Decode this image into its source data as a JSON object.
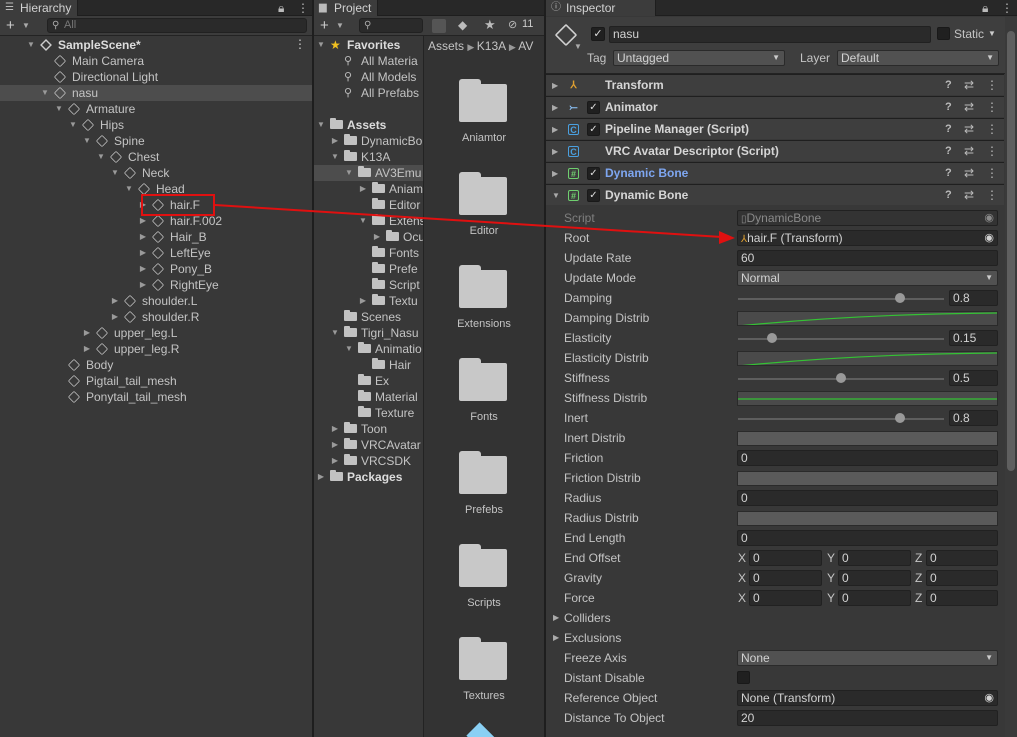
{
  "hierarchy": {
    "tab": "Hierarchy",
    "search_placeholder": "All",
    "items": [
      {
        "label": "SampleScene*",
        "indent": 0,
        "fold": "open",
        "icon": "unity-scene-icon",
        "bold": true
      },
      {
        "label": "Main Camera",
        "indent": 1,
        "fold": "",
        "icon": "gameobject-icon"
      },
      {
        "label": "Directional Light",
        "indent": 1,
        "fold": "",
        "icon": "gameobject-icon"
      },
      {
        "label": "nasu",
        "indent": 1,
        "fold": "open",
        "icon": "gameobject-icon",
        "selected": true
      },
      {
        "label": "Armature",
        "indent": 2,
        "fold": "open",
        "icon": "gameobject-icon"
      },
      {
        "label": "Hips",
        "indent": 3,
        "fold": "open",
        "icon": "gameobject-icon"
      },
      {
        "label": "Spine",
        "indent": 4,
        "fold": "open",
        "icon": "gameobject-icon"
      },
      {
        "label": "Chest",
        "indent": 5,
        "fold": "open",
        "icon": "gameobject-icon"
      },
      {
        "label": "Neck",
        "indent": 6,
        "fold": "open",
        "icon": "gameobject-icon"
      },
      {
        "label": "Head",
        "indent": 7,
        "fold": "open",
        "icon": "gameobject-icon"
      },
      {
        "label": "hair.F",
        "indent": 8,
        "fold": "closed",
        "icon": "gameobject-icon",
        "highlight": true
      },
      {
        "label": "hair.F.002",
        "indent": 8,
        "fold": "closed",
        "icon": "gameobject-icon"
      },
      {
        "label": "Hair_B",
        "indent": 8,
        "fold": "closed",
        "icon": "gameobject-icon"
      },
      {
        "label": "LeftEye",
        "indent": 8,
        "fold": "closed",
        "icon": "gameobject-icon"
      },
      {
        "label": "Pony_B",
        "indent": 8,
        "fold": "closed",
        "icon": "gameobject-icon"
      },
      {
        "label": "RightEye",
        "indent": 8,
        "fold": "closed",
        "icon": "gameobject-icon"
      },
      {
        "label": "shoulder.L",
        "indent": 6,
        "fold": "closed",
        "icon": "gameobject-icon"
      },
      {
        "label": "shoulder.R",
        "indent": 6,
        "fold": "closed",
        "icon": "gameobject-icon"
      },
      {
        "label": "upper_leg.L",
        "indent": 4,
        "fold": "closed",
        "icon": "gameobject-icon"
      },
      {
        "label": "upper_leg.R",
        "indent": 4,
        "fold": "closed",
        "icon": "gameobject-icon"
      },
      {
        "label": "Body",
        "indent": 2,
        "fold": "",
        "icon": "gameobject-icon"
      },
      {
        "label": "Pigtail_tail_mesh",
        "indent": 2,
        "fold": "",
        "icon": "gameobject-icon"
      },
      {
        "label": "Ponytail_tail_mesh",
        "indent": 2,
        "fold": "",
        "icon": "gameobject-icon"
      }
    ]
  },
  "project": {
    "tab": "Project",
    "hidden_count": "11",
    "breadcrumb": [
      "Assets",
      "K13A",
      "AV"
    ],
    "tree": [
      {
        "label": "Favorites",
        "indent": 0,
        "fold": "open",
        "icon": "star-icon",
        "bold": true
      },
      {
        "label": "All Materia",
        "indent": 1,
        "fold": "",
        "icon": "search-icon"
      },
      {
        "label": "All Models",
        "indent": 1,
        "fold": "",
        "icon": "search-icon"
      },
      {
        "label": "All Prefabs",
        "indent": 1,
        "fold": "",
        "icon": "search-icon"
      },
      {
        "label": "",
        "indent": 0,
        "fold": "",
        "icon": ""
      },
      {
        "label": "Assets",
        "indent": 0,
        "fold": "open",
        "icon": "folder-icon",
        "bold": true
      },
      {
        "label": "DynamicBo",
        "indent": 1,
        "fold": "closed",
        "icon": "folder-icon"
      },
      {
        "label": "K13A",
        "indent": 1,
        "fold": "open",
        "icon": "folder-icon"
      },
      {
        "label": "AV3Emu",
        "indent": 2,
        "fold": "open",
        "icon": "folder-icon",
        "selected": true
      },
      {
        "label": "Aniam",
        "indent": 3,
        "fold": "closed",
        "icon": "folder-icon"
      },
      {
        "label": "Editor",
        "indent": 3,
        "fold": "",
        "icon": "folder-icon"
      },
      {
        "label": "Extens",
        "indent": 3,
        "fold": "open",
        "icon": "folder-icon"
      },
      {
        "label": "Ocu",
        "indent": 4,
        "fold": "closed",
        "icon": "folder-icon"
      },
      {
        "label": "Fonts",
        "indent": 3,
        "fold": "",
        "icon": "folder-icon"
      },
      {
        "label": "Prefe",
        "indent": 3,
        "fold": "",
        "icon": "folder-icon"
      },
      {
        "label": "Script",
        "indent": 3,
        "fold": "",
        "icon": "folder-icon"
      },
      {
        "label": "Textu",
        "indent": 3,
        "fold": "closed",
        "icon": "folder-icon"
      },
      {
        "label": "Scenes",
        "indent": 1,
        "fold": "",
        "icon": "folder-icon"
      },
      {
        "label": "Tigri_Nasu",
        "indent": 1,
        "fold": "open",
        "icon": "folder-icon"
      },
      {
        "label": "Animatio",
        "indent": 2,
        "fold": "open",
        "icon": "folder-icon"
      },
      {
        "label": "Hair",
        "indent": 3,
        "fold": "",
        "icon": "folder-icon"
      },
      {
        "label": "Ex",
        "indent": 2,
        "fold": "",
        "icon": "folder-icon"
      },
      {
        "label": "Material",
        "indent": 2,
        "fold": "",
        "icon": "folder-icon"
      },
      {
        "label": "Texture",
        "indent": 2,
        "fold": "",
        "icon": "folder-icon"
      },
      {
        "label": "Toon",
        "indent": 1,
        "fold": "closed",
        "icon": "folder-icon"
      },
      {
        "label": "VRCAvatar",
        "indent": 1,
        "fold": "closed",
        "icon": "folder-icon"
      },
      {
        "label": "VRCSDK",
        "indent": 1,
        "fold": "closed",
        "icon": "folder-icon"
      },
      {
        "label": "Packages",
        "indent": 0,
        "fold": "closed",
        "icon": "folder-icon",
        "bold": true
      }
    ],
    "grid": [
      "Aniamtor",
      "Editor",
      "Extensions",
      "Fonts",
      "Prefebs",
      "Scripts",
      "Textures"
    ]
  },
  "inspector": {
    "tab": "Inspector",
    "object_name": "nasu",
    "static_label": "Static",
    "tag_label": "Tag",
    "tag_value": "Untagged",
    "layer_label": "Layer",
    "layer_value": "Default",
    "components": [
      {
        "name": "Transform",
        "checkbox": false,
        "icon": "transform-icon",
        "color": "#d6d6d6"
      },
      {
        "name": "Animator",
        "checkbox": true,
        "icon": "animator-icon",
        "color": "#d6d6d6"
      },
      {
        "name": "Pipeline Manager (Script)",
        "checkbox": true,
        "icon": "csharp-script-icon",
        "color": "#d6d6d6"
      },
      {
        "name": "VRC Avatar Descriptor (Script)",
        "checkbox": false,
        "icon": "csharp-script-icon",
        "color": "#d6d6d6"
      },
      {
        "name": "Dynamic Bone",
        "checkbox": true,
        "icon": "script-hash-icon",
        "color": "#7ea6f0"
      },
      {
        "name": "Dynamic Bone",
        "checkbox": true,
        "icon": "script-hash-icon",
        "color": "#d6d6d6"
      }
    ],
    "props": {
      "script_label": "Script",
      "script_value": "DynamicBone",
      "root_label": "Root",
      "root_value": "hair.F (Transform)",
      "update_rate_label": "Update Rate",
      "update_rate_value": "60",
      "update_mode_label": "Update Mode",
      "update_mode_value": "Normal",
      "damping_label": "Damping",
      "damping_value": "0.8",
      "damping_distrib_label": "Damping Distrib",
      "elasticity_label": "Elasticity",
      "elasticity_value": "0.15",
      "elasticity_distrib_label": "Elasticity Distrib",
      "stiffness_label": "Stiffness",
      "stiffness_value": "0.5",
      "stiffness_distrib_label": "Stiffness Distrib",
      "inert_label": "Inert",
      "inert_value": "0.8",
      "inert_distrib_label": "Inert Distrib",
      "friction_label": "Friction",
      "friction_value": "0",
      "friction_distrib_label": "Friction Distrib",
      "radius_label": "Radius",
      "radius_value": "0",
      "radius_distrib_label": "Radius Distrib",
      "end_length_label": "End Length",
      "end_length_value": "0",
      "end_offset_label": "End Offset",
      "gravity_label": "Gravity",
      "force_label": "Force",
      "x_label": "X",
      "y_label": "Y",
      "z_label": "Z",
      "end_offset": [
        "0",
        "0",
        "0"
      ],
      "gravity": [
        "0",
        "0",
        "0"
      ],
      "force": [
        "0",
        "0",
        "0"
      ],
      "colliders_label": "Colliders",
      "exclusions_label": "Exclusions",
      "freeze_axis_label": "Freeze Axis",
      "freeze_axis_value": "None",
      "distant_disable_label": "Distant Disable",
      "reference_object_label": "Reference Object",
      "reference_object_value": "None (Transform)",
      "distance_to_object_label": "Distance To Object",
      "distance_to_object_value": "20"
    }
  },
  "colors": {
    "highlight": "#e01010",
    "curve": "#34c234",
    "selection": "#2c5d87"
  }
}
